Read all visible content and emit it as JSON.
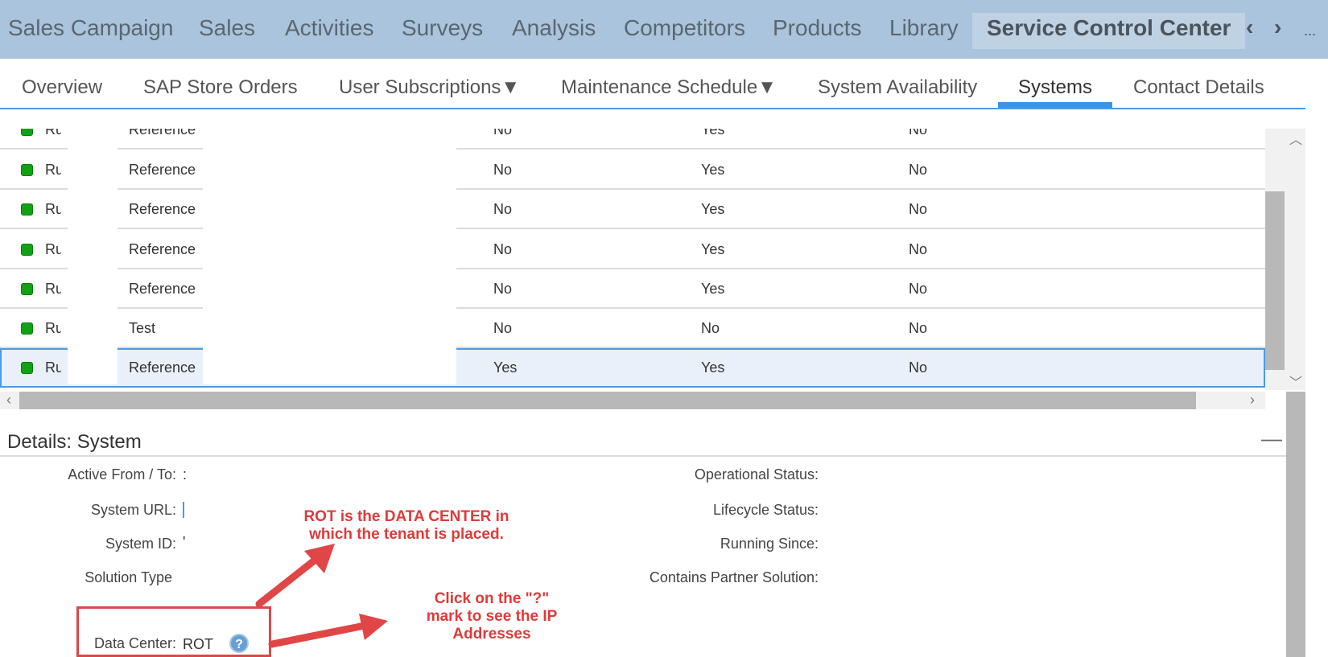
{
  "top_nav": {
    "tabs": [
      "Sales Campaign",
      "Sales",
      "Activities",
      "Surveys",
      "Analysis",
      "Competitors",
      "Products",
      "Library",
      "Service Control Center"
    ],
    "active": "Service Control Center",
    "prev": "‹",
    "next": "›",
    "more": "..."
  },
  "sub_tabs": {
    "items": [
      "Overview",
      "SAP Store Orders",
      "User Subscriptions▼",
      "Maintenance Schedule▼",
      "System Availability",
      "Systems",
      "Contact Details"
    ],
    "active": "Systems"
  },
  "table": {
    "rows": [
      {
        "name": "Ru",
        "type": "Reference",
        "c1": "No",
        "c2": "Yes",
        "c3": "No",
        "selected": false
      },
      {
        "name": "Ru",
        "type": "Reference",
        "c1": "No",
        "c2": "Yes",
        "c3": "No",
        "selected": false
      },
      {
        "name": "Ru",
        "type": "Reference",
        "c1": "No",
        "c2": "Yes",
        "c3": "No",
        "selected": false
      },
      {
        "name": "Ru",
        "type": "Reference",
        "c1": "No",
        "c2": "Yes",
        "c3": "No",
        "selected": false
      },
      {
        "name": "Ru",
        "type": "Reference",
        "c1": "No",
        "c2": "Yes",
        "c3": "No",
        "selected": false
      },
      {
        "name": "Ru",
        "type": "Test",
        "c1": "No",
        "c2": "No",
        "c3": "No",
        "selected": false
      },
      {
        "name": "Ru",
        "type": "Reference",
        "c1": "Yes",
        "c2": "Yes",
        "c3": "No",
        "selected": true
      }
    ],
    "status_color": "#12a115"
  },
  "scroll": {
    "up": "︿",
    "down": "﹀",
    "left": "‹",
    "right": "›"
  },
  "details": {
    "title": "Details: System",
    "collapse": "—",
    "left_fields": [
      {
        "label": "Active From / To:",
        "value": ":"
      },
      {
        "label": "System URL:",
        "value": ""
      },
      {
        "label": "System ID:",
        "value": "'"
      },
      {
        "label": "Solution Type",
        "value": ""
      },
      {
        "label": "Data Center:",
        "value": "ROT"
      }
    ],
    "right_fields": [
      {
        "label": "Operational Status:",
        "value": ""
      },
      {
        "label": "Lifecycle Status:",
        "value": ""
      },
      {
        "label": "Running Since:",
        "value": ""
      },
      {
        "label": "Contains Partner Solution:",
        "value": ""
      }
    ],
    "help": "?"
  },
  "annotations": {
    "rot": "ROT is the DATA CENTER in which the tenant is placed.",
    "click": "Click on the \"?\" mark to see the IP Addresses",
    "color": "#e03a3a"
  }
}
